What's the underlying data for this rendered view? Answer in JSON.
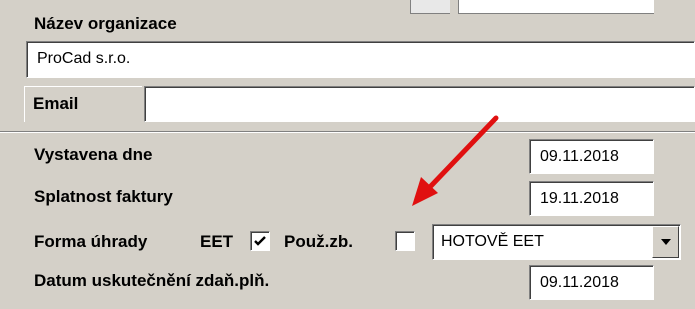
{
  "organization": {
    "name_label": "Název organizace",
    "name_value": "ProCad s.r.o.",
    "email_label": "Email",
    "email_value": ""
  },
  "invoice": {
    "issued_label": "Vystavena dne",
    "issued_value": "09.11.2018",
    "due_label": "Splatnost faktury",
    "due_value": "19.11.2018",
    "payment_label": "Forma úhrady",
    "eet_label": "EET",
    "eet_checked": true,
    "used_label": "Použ.zb.",
    "used_checked": false,
    "payment_value": "HOTOVĚ EET",
    "taxable_label": "Datum uskutečnění zdaň.plň.",
    "taxable_value": "09.11.2018"
  },
  "icons": {
    "checkmark": "check-icon",
    "dropdown": "chevron-down-icon",
    "annotation": "red-arrow"
  },
  "colors": {
    "panel_bg": "#d4d0c8",
    "annotation": "#e01010"
  }
}
